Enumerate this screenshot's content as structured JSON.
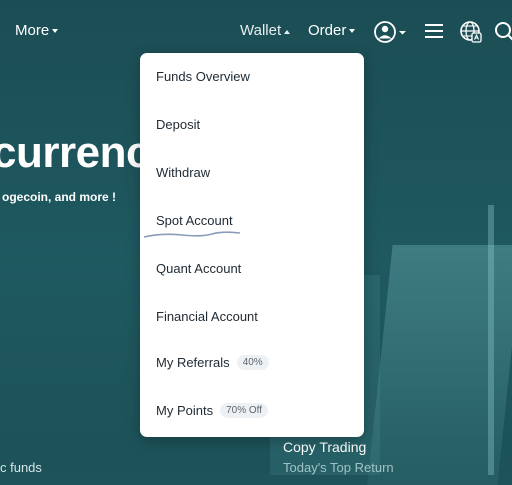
{
  "nav": {
    "more_label": "More",
    "wallet_label": "Wallet",
    "order_label": "Order",
    "icons": [
      "user-icon",
      "menu-icon",
      "globe-icon",
      "search-icon"
    ]
  },
  "hero": {
    "title": "currenc",
    "subtitle": "ogecoin, and more !",
    "funds_text": "c funds"
  },
  "copy_trading": {
    "title": "Copy Trading",
    "subtitle": "Today's Top Return"
  },
  "wallet_menu": {
    "items": [
      {
        "label": "Funds Overview",
        "badge": ""
      },
      {
        "label": "Deposit",
        "badge": ""
      },
      {
        "label": "Withdraw",
        "badge": ""
      },
      {
        "label": "Spot Account",
        "badge": ""
      },
      {
        "label": "Quant Account",
        "badge": ""
      },
      {
        "label": "Financial Account",
        "badge": ""
      },
      {
        "label": "My Referrals",
        "badge": "40%"
      },
      {
        "label": "My Points",
        "badge": "70% Off"
      }
    ]
  },
  "colors": {
    "background": "#1f535a",
    "menu_background": "#ffffff",
    "menu_text": "#1e2a33",
    "badge_background": "#eef1f3"
  }
}
